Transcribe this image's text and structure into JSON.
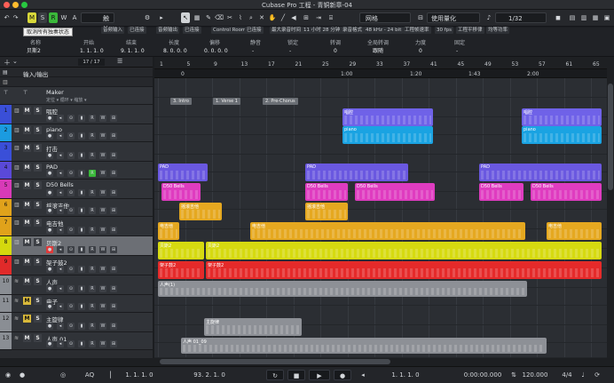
{
  "window_title": "Cubase Pro 工程 - 青铜新章-04",
  "toolbar": {
    "mode_buttons": [
      "M",
      "S",
      "R",
      "W",
      "A"
    ],
    "touch_mode": "触控",
    "grid_type": "网格",
    "quantize_mode": "使用量化",
    "quantize_value": "1/32"
  },
  "tooltip": "取消所有独奏状态",
  "infoline": {
    "headers": [
      "名称",
      "开始",
      "结束",
      "长度",
      "偏移",
      "静音",
      "锁定",
      "转调",
      "全局转调",
      "力度",
      "固定"
    ],
    "values": [
      "贝斯2",
      "1. 1. 1. 0",
      "9. 1. 1. 0",
      "8. 0. 0. 0",
      "0. 0. 0. 0",
      "-",
      "-",
      "0",
      "跟随",
      "0",
      "-"
    ]
  },
  "hbuttons": [
    "音频输入",
    "已连接",
    "音频输出",
    "已连接",
    "Control Room",
    "已连接",
    "最大录音时间",
    "11 小时 28 分钟",
    "录音格式",
    "48 kHz - 24 bit",
    "工程帧速率",
    "30 fps",
    "工程平移律",
    "均等功率"
  ],
  "track_header": {
    "counter": "17 / 17",
    "io_label": "输入/输出"
  },
  "tracks": [
    {
      "num": "",
      "name": "Maker",
      "color": "#8a8e94",
      "sub": "定位  ▾  循环  ▾  缩放  ▾"
    },
    {
      "num": "1",
      "name": "唱腔",
      "color": "#3a4fd8"
    },
    {
      "num": "2",
      "name": "piano",
      "color": "#1b9be0"
    },
    {
      "num": "3",
      "name": "打击",
      "color": "#3a4fd8"
    },
    {
      "num": "4",
      "name": "PAD",
      "color": "#5a49d8"
    },
    {
      "num": "5",
      "name": "D50 Bells",
      "color": "#d83ab8"
    },
    {
      "num": "6",
      "name": "摇滚吉他",
      "color": "#e0a21b"
    },
    {
      "num": "7",
      "name": "电吉他",
      "color": "#e0a21b"
    },
    {
      "num": "8",
      "name": "贝斯2",
      "color": "#d4d80e"
    },
    {
      "num": "9",
      "name": "架子鼓2",
      "color": "#e02a2a"
    },
    {
      "num": "10",
      "name": "人声",
      "color": "#8a8e94"
    },
    {
      "num": "11",
      "name": "电子",
      "color": "#8a8e94"
    },
    {
      "num": "12",
      "name": "主旋律",
      "color": "#8a8e94"
    },
    {
      "num": "13",
      "name": "人声 01",
      "color": "#8a8e94"
    }
  ],
  "ruler": [
    "1",
    "5",
    "9",
    "13",
    "17",
    "21",
    "25",
    "29",
    "33",
    "37",
    "41",
    "45",
    "49",
    "53",
    "57",
    "61",
    "65"
  ],
  "timeline": [
    "0",
    "1:00",
    "1:20",
    "1:43",
    "2:00"
  ],
  "markers": [
    "3. Intro",
    "1. Verse 1",
    "2. Pre-Chorus"
  ],
  "part_labels": {
    "vocal": "唱腔",
    "piano": "piano",
    "pad": "PAD",
    "bells": "D50 Bells",
    "rock": "摇滚吉他",
    "egtr": "电吉他",
    "bass": "贝斯2",
    "drum": "架子鼓2",
    "voice": "人声(1)",
    "lead": "主旋律",
    "voice01": "人声 01_09"
  },
  "transport": {
    "left_locator": "1. 1. 1. 0",
    "right_locator": "93. 2. 1. 0",
    "position": "1. 1. 1. 0",
    "time": "0:00:00.000",
    "tempo": "120.000",
    "signature": "4/4"
  },
  "colors": {
    "bg": "#1b1d20",
    "accent": "#4bc5d8"
  }
}
